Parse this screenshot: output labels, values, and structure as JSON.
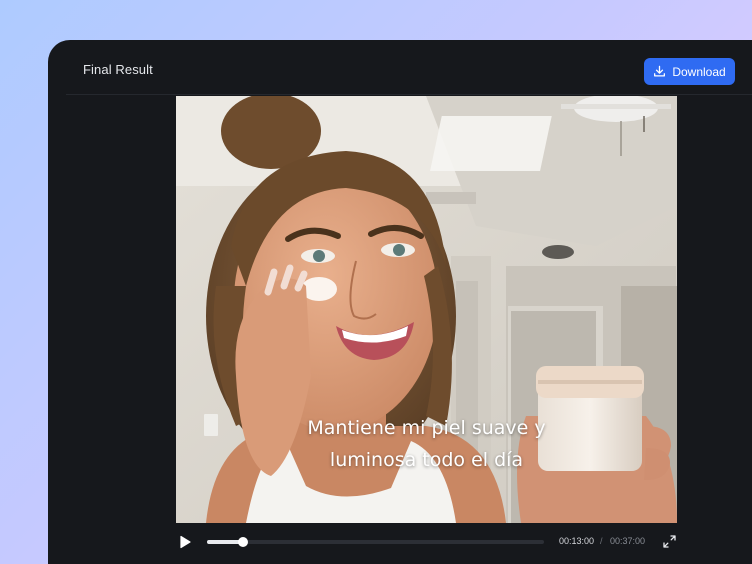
{
  "window": {
    "title": "Final Result"
  },
  "toolbar": {
    "download_label": "Download",
    "download_icon": "download-icon"
  },
  "video": {
    "subtitle_lines": [
      "Mantiene mi piel suave y",
      "luminosa todo el día"
    ],
    "current_time": "00:13:00",
    "separator": "/",
    "total_time": "00:37:00",
    "progress_fraction": 0.108
  },
  "colors": {
    "accent": "#2f6bf2",
    "window_bg": "#16181c"
  }
}
